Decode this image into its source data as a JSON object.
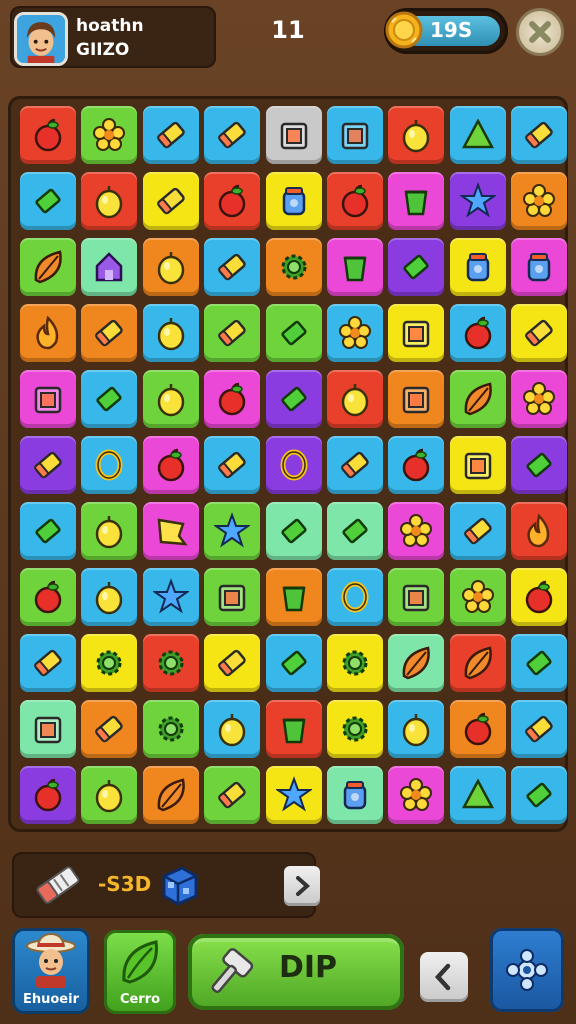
{
  "header": {
    "player_name": "hoathn",
    "player_code": "GIIZO",
    "level": "11",
    "coins": "19S",
    "icons": {
      "avatar": "player-avatar",
      "coin": "gold-coin-icon",
      "close": "close-x-icon"
    }
  },
  "colors": {
    "R": "#e8402a",
    "O": "#f0861e",
    "Y": "#f6e514",
    "G": "#6fd43c",
    "L": "#38b8ea",
    "M": "#ec48d8",
    "P": "#8a3ce0",
    "W": "#c9c9c9",
    "T": "#7de6a8"
  },
  "board": {
    "rows": [
      [
        {
          "c": "R",
          "i": "apple"
        },
        {
          "c": "G",
          "i": "flower"
        },
        {
          "c": "L",
          "i": "candy"
        },
        {
          "c": "L",
          "i": "candy"
        },
        {
          "c": "W",
          "i": "box"
        },
        {
          "c": "L",
          "i": "box"
        },
        {
          "c": "R",
          "i": "lemon"
        },
        {
          "c": "L",
          "i": "triangle"
        },
        {
          "c": "L",
          "i": "candy"
        }
      ],
      [
        {
          "c": "L",
          "i": "gem"
        },
        {
          "c": "R",
          "i": "lemon"
        },
        {
          "c": "Y",
          "i": "candy"
        },
        {
          "c": "R",
          "i": "apple"
        },
        {
          "c": "Y",
          "i": "jar"
        },
        {
          "c": "R",
          "i": "apple"
        },
        {
          "c": "M",
          "i": "cup"
        },
        {
          "c": "P",
          "i": "star"
        },
        {
          "c": "O",
          "i": "flower"
        }
      ],
      [
        {
          "c": "G",
          "i": "leaf"
        },
        {
          "c": "T",
          "i": "house"
        },
        {
          "c": "O",
          "i": "lemon"
        },
        {
          "c": "L",
          "i": "candy"
        },
        {
          "c": "O",
          "i": "gear"
        },
        {
          "c": "M",
          "i": "cup"
        },
        {
          "c": "P",
          "i": "gem"
        },
        {
          "c": "Y",
          "i": "jar"
        },
        {
          "c": "M",
          "i": "jar"
        }
      ],
      [
        {
          "c": "O",
          "i": "flame"
        },
        {
          "c": "O",
          "i": "candy"
        },
        {
          "c": "L",
          "i": "lemon"
        },
        {
          "c": "G",
          "i": "candy"
        },
        {
          "c": "G",
          "i": "gem"
        },
        {
          "c": "L",
          "i": "flower"
        },
        {
          "c": "Y",
          "i": "box"
        },
        {
          "c": "L",
          "i": "apple"
        },
        {
          "c": "Y",
          "i": "candy"
        }
      ],
      [
        {
          "c": "M",
          "i": "box"
        },
        {
          "c": "L",
          "i": "gem"
        },
        {
          "c": "G",
          "i": "lemon"
        },
        {
          "c": "M",
          "i": "apple"
        },
        {
          "c": "P",
          "i": "gem"
        },
        {
          "c": "R",
          "i": "lemon"
        },
        {
          "c": "O",
          "i": "box"
        },
        {
          "c": "G",
          "i": "leaf"
        },
        {
          "c": "M",
          "i": "flower"
        }
      ],
      [
        {
          "c": "P",
          "i": "candy"
        },
        {
          "c": "L",
          "i": "ring"
        },
        {
          "c": "M",
          "i": "apple"
        },
        {
          "c": "L",
          "i": "candy"
        },
        {
          "c": "P",
          "i": "ring"
        },
        {
          "c": "L",
          "i": "candy"
        },
        {
          "c": "L",
          "i": "apple"
        },
        {
          "c": "Y",
          "i": "box"
        },
        {
          "c": "P",
          "i": "gem"
        }
      ],
      [
        {
          "c": "L",
          "i": "gem"
        },
        {
          "c": "G",
          "i": "lemon"
        },
        {
          "c": "M",
          "i": "flag"
        },
        {
          "c": "G",
          "i": "star"
        },
        {
          "c": "T",
          "i": "gem"
        },
        {
          "c": "T",
          "i": "gem"
        },
        {
          "c": "M",
          "i": "flower"
        },
        {
          "c": "L",
          "i": "candy"
        },
        {
          "c": "R",
          "i": "flame"
        }
      ],
      [
        {
          "c": "G",
          "i": "apple"
        },
        {
          "c": "L",
          "i": "lemon"
        },
        {
          "c": "L",
          "i": "star"
        },
        {
          "c": "G",
          "i": "box"
        },
        {
          "c": "O",
          "i": "cup"
        },
        {
          "c": "L",
          "i": "ring"
        },
        {
          "c": "G",
          "i": "box"
        },
        {
          "c": "G",
          "i": "flower"
        },
        {
          "c": "Y",
          "i": "apple"
        }
      ],
      [
        {
          "c": "L",
          "i": "candy"
        },
        {
          "c": "Y",
          "i": "gear"
        },
        {
          "c": "R",
          "i": "gear"
        },
        {
          "c": "Y",
          "i": "candy"
        },
        {
          "c": "L",
          "i": "gem"
        },
        {
          "c": "Y",
          "i": "gear"
        },
        {
          "c": "T",
          "i": "leaf"
        },
        {
          "c": "R",
          "i": "leaf"
        },
        {
          "c": "L",
          "i": "gem"
        }
      ],
      [
        {
          "c": "T",
          "i": "box"
        },
        {
          "c": "O",
          "i": "candy"
        },
        {
          "c": "G",
          "i": "gear"
        },
        {
          "c": "L",
          "i": "lemon"
        },
        {
          "c": "R",
          "i": "cup"
        },
        {
          "c": "Y",
          "i": "gear"
        },
        {
          "c": "L",
          "i": "lemon"
        },
        {
          "c": "O",
          "i": "apple"
        },
        {
          "c": "L",
          "i": "candy"
        }
      ],
      [
        {
          "c": "P",
          "i": "apple"
        },
        {
          "c": "G",
          "i": "lemon"
        },
        {
          "c": "O",
          "i": "leaf"
        },
        {
          "c": "G",
          "i": "candy"
        },
        {
          "c": "Y",
          "i": "star"
        },
        {
          "c": "T",
          "i": "jar"
        },
        {
          "c": "M",
          "i": "flower"
        },
        {
          "c": "L",
          "i": "triangle"
        },
        {
          "c": "L",
          "i": "gem"
        }
      ]
    ]
  },
  "booster": {
    "text": "-S3D",
    "icons": [
      "eraser-pencil-icon",
      "blue-cube-icon"
    ]
  },
  "bottom": {
    "profile_label": "Ehuoeir",
    "green_label": "Cerro",
    "play_label": "DIP"
  }
}
